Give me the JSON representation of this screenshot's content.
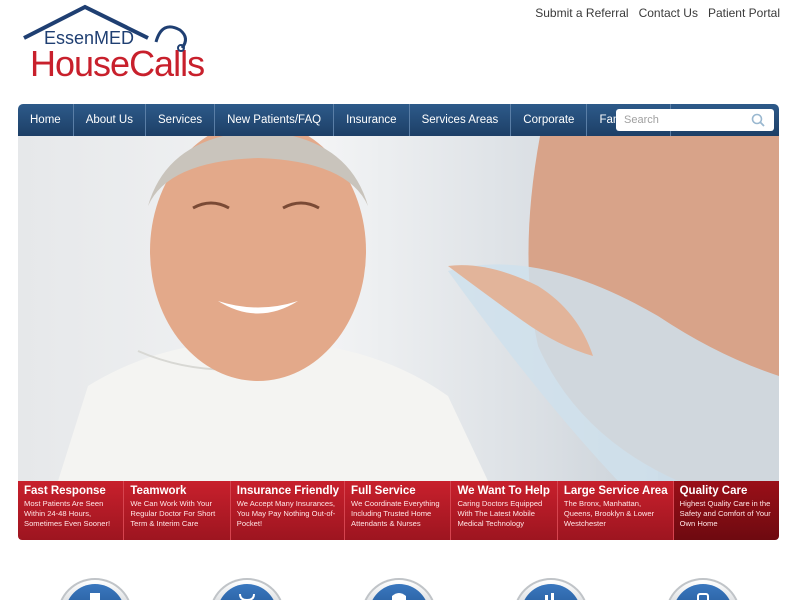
{
  "logo": {
    "line1": "EssenMED",
    "line2": "HouseCalls"
  },
  "top_links": [
    "Submit a Referral",
    "Contact Us",
    "Patient Portal"
  ],
  "nav": [
    "Home",
    "About Us",
    "Services",
    "New Patients/FAQ",
    "Insurance",
    "Services Areas",
    "Corporate",
    "Family Line"
  ],
  "search": {
    "placeholder": "Search"
  },
  "features": [
    {
      "title": "Fast Response",
      "desc": "Most Patients Are Seen Within 24-48 Hours, Sometimes Even Sooner!"
    },
    {
      "title": "Teamwork",
      "desc": "We Can Work With Your Regular Doctor For Short Term & Interim Care"
    },
    {
      "title": "Insurance Friendly",
      "desc": "We Accept Many Insurances, You May Pay Nothing Out-of-Pocket!"
    },
    {
      "title": "Full Service",
      "desc": "We Coordinate Everything Including Trusted Home Attendants & Nurses"
    },
    {
      "title": "We Want To Help",
      "desc": "Caring Doctors Equipped With The Latest Mobile Medical Technology"
    },
    {
      "title": "Large Service Area",
      "desc": "The Bronx, Manhattan, Queens, Brooklyn & Lower Westchester"
    },
    {
      "title": "Quality Care",
      "desc": "Highest Quality Care in the Safety and Comfort of Your Own Home"
    }
  ],
  "bottom_icons": [
    "document-icon",
    "stethoscope-icon",
    "nurse-icon",
    "calendar-icon",
    "phone-icon"
  ],
  "colors": {
    "nav": "#1d3f66",
    "brand_red": "#c8202c",
    "quality_red": "#8a0d15",
    "brand_blue": "#1f3f72"
  }
}
